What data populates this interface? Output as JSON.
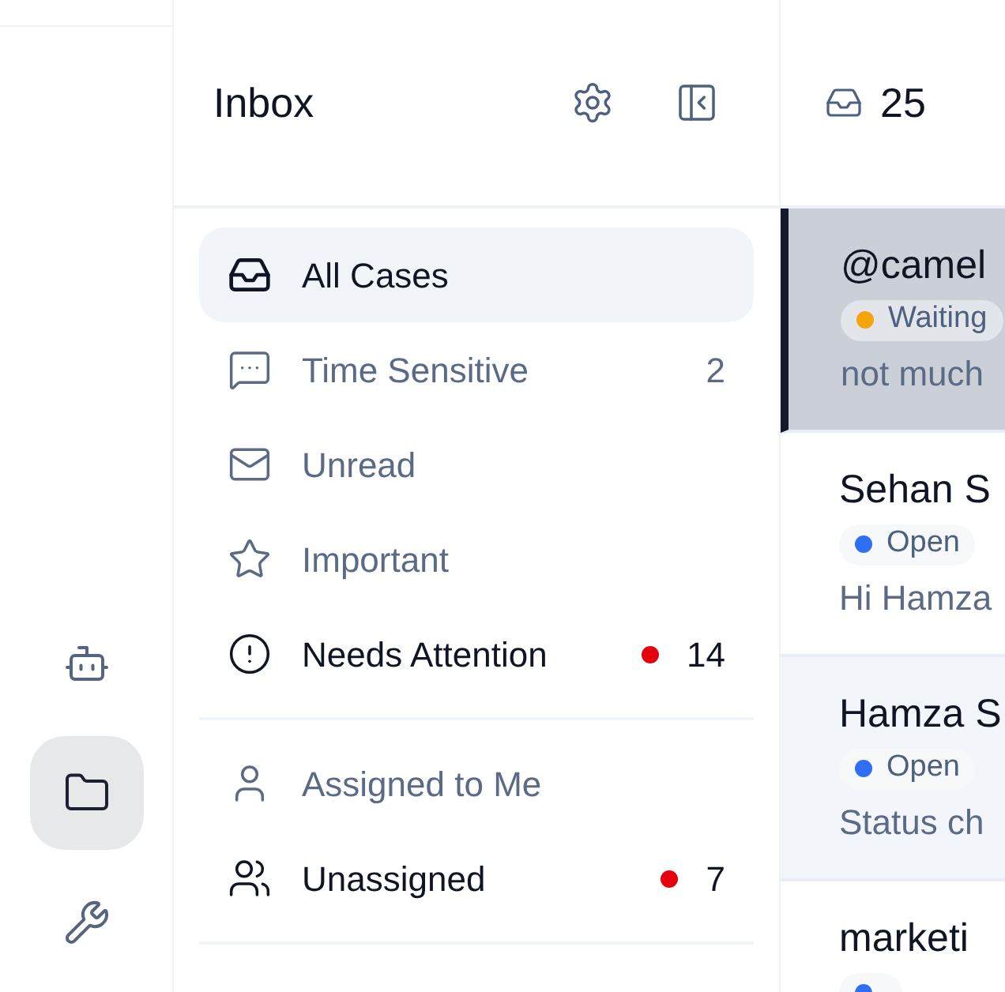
{
  "rail": {
    "items": [
      {
        "kind": "robot",
        "selected": false
      },
      {
        "kind": "folder",
        "selected": true
      },
      {
        "kind": "wrench",
        "selected": false
      }
    ]
  },
  "inbox": {
    "title": "Inbox",
    "groups": [
      [
        {
          "kind": "inbox",
          "label": "All Cases",
          "selected": true,
          "alert": false
        },
        {
          "kind": "message",
          "label": "Time Sensitive",
          "count": "2",
          "selected": false,
          "alert": false
        },
        {
          "kind": "mail",
          "label": "Unread",
          "selected": false,
          "alert": false
        },
        {
          "kind": "star",
          "label": "Important",
          "selected": false,
          "alert": false
        },
        {
          "kind": "alert",
          "label": "Needs Attention",
          "count": "14",
          "selected": false,
          "alert": true
        }
      ],
      [
        {
          "kind": "user",
          "label": "Assigned to Me",
          "selected": false,
          "alert": false
        },
        {
          "kind": "users",
          "label": "Unassigned",
          "count": "7",
          "selected": false,
          "alert": true
        }
      ]
    ]
  },
  "cases": {
    "count": "25",
    "rows": [
      {
        "title": "@camel",
        "status": {
          "label": "Waiting",
          "color": "#f5a50b"
        },
        "preview": "not much",
        "selected": true
      },
      {
        "title": "Sehan S",
        "status": {
          "label": "Open",
          "color": "#2f6ff5"
        },
        "preview": "Hi Hamza",
        "selected": false,
        "shaded": false
      },
      {
        "title": "Hamza S",
        "status": {
          "label": "Open",
          "color": "#2f6ff5"
        },
        "preview": "Status ch",
        "selected": false,
        "shaded": true
      },
      {
        "title": "marketi",
        "status": {
          "color": "#2f6ff5"
        },
        "selected": false,
        "shaded": false
      }
    ]
  }
}
